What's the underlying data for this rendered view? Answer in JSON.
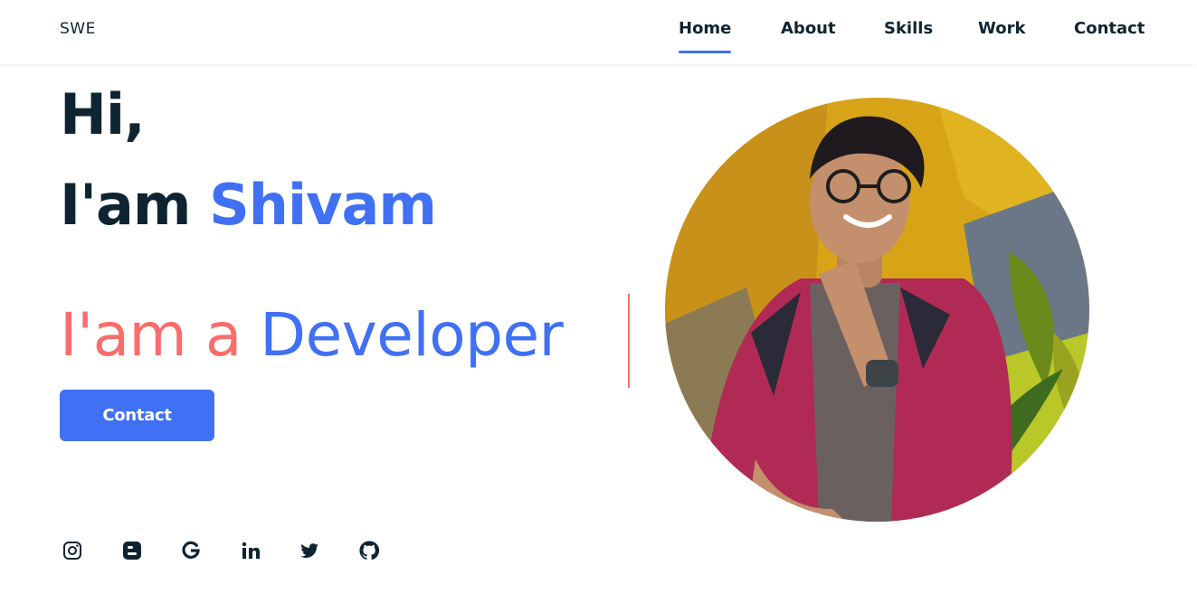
{
  "header": {
    "logo": "SWE",
    "nav": [
      {
        "label": "Home",
        "active": true
      },
      {
        "label": "About",
        "active": false
      },
      {
        "label": "Skills",
        "active": false
      },
      {
        "label": "Work",
        "active": false
      },
      {
        "label": "Contact",
        "active": false
      }
    ]
  },
  "hero": {
    "greeting": "Hi,",
    "intro": "I'am",
    "name": "Shivam",
    "typed_prefix": "I'am a",
    "typed_role": "Developer",
    "button_label": "Contact"
  },
  "socials": [
    "instagram-icon",
    "blogger-icon",
    "google-icon",
    "linkedin-icon",
    "twitter-icon",
    "github-icon"
  ],
  "colors": {
    "accent": "#4070f4",
    "coral": "#fc6c6c",
    "text": "#0e2431"
  }
}
